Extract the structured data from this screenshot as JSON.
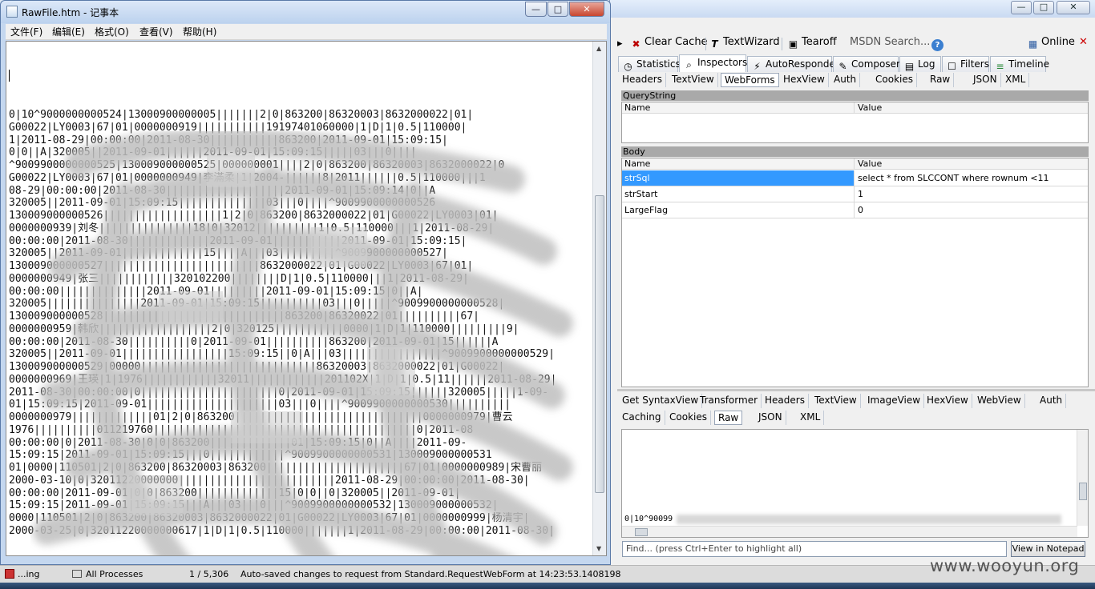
{
  "notepad": {
    "title": "RawFile.htm - 记事本",
    "menus": [
      "文件(F)",
      "编辑(E)",
      "格式(O)",
      "查看(V)",
      "帮助(H)"
    ],
    "window_buttons": {
      "minimize": "—",
      "maximize": "□",
      "close": "✕"
    },
    "lines": [
      "0|10^9000000000524|13000900000005|||||||2|0|863200|86320003|8632000022|01|",
      "G00022|LY0003|67|01|0000000919|||||||||||19197401060000|1|D|1|0.5|110000|",
      "1|2011-08-29|00:00:00|2011-08-30|||||||||||863200|2011-09-01|15:09:15|",
      "0|0||A|320005||2011-09-01||||||2011-09-01|15:09:15|||||03|||0||||",
      "^9009900000000525|130009000000525|000000001||||2|0|863200|86320003|8632000022|0",
      "G00022|LY0003|67|01|0000000949|李滿柔|1|2004-||||||8|2011||||||0.5|110000|||1",
      "08-29|00:00:00|2011-08-30|||||||||||||||||||2011-09-01|15:09:14|0||A",
      "320005||2011-09-01|15:09:15||||||||||||||03|||0||||^9009900000000526",
      "130009000000526|||||||||||||||||||1|2|0|863200|8632000022|01|G00022|LY0003|01|",
      "0000000939|刘冬|||||||||||||||18|0|32012||||||||||1|0.5|110000|||1|2011-08-29|",
      "00:00:00|2011-08-30|||||||||||||2011-09-01|||||||||||2011-09-01|15:09:15|",
      "320005||2011-09-01|||||||||||||15||||A|||03|||||||||^9009900000000527|",
      "130009000000527|||||||||||||||||||||||||8632000022|01|G00022|LY0003|67|01|",
      "0000000949|张三||||||||||||320102200||||||||D|1|0.5|110000|||1|2011-08-29|",
      "00:00:00||||||||||||||2011-09-01|||||||||2011-09-01|15:09:15|0||A|",
      "320005|||||||||||||||2011-09-01|15:09:15||||||||||03|||0|||||^9009900000000528|",
      "130009000000528|||||||||||||||||||||||||||||863200|86320022|01||||||||||67|",
      "0000000959|韩欣||||||||||||||||||2|0|320125|||||||||||0000|1|D|1|110000|||||||||9|",
      "00:00:00|2011-08-30||||||||||0|2011-09-01||||||||||863200|2011-09-01|15||||||A",
      "320005||2011-09-01|||||||||||||||||15:09:15||0|A|||03||||||||||||||||^9009900000000529|",
      "130009000000529|00000||||||||||||||||||||||||||||86320003|8632000022|01|G00022|",
      "0000000969|王瑛|1|1976||||||||||||32011||||||||||||201102X|1|D|1|0.5|11||||||2011-08-29|",
      "2011-08-30|00:00:00|0||||||||||||||||||||||0|2011-09-01|15:09:15||||||320005|||||1-09-",
      "01|15:09:15|2011-09-01|||||||||||||||||||||03|||0||||^9009900000000530||||||||||",
      "0000000979|||||||||||||01|2|0|863200||||||||||||||||||||||||||||||0000000979|曹云",
      "1976||||||||||011219760||||||||||||||||||||||||||||||||||||||||||0|2011-08",
      "00:00:00|0|2011-08-30|0|0|863200|||||||||||||01|15:09:15|0||A||||2011-09-",
      "15:09:15|2011-09-01|15:09:15|||0||||||||||||^9009900000000531|130009000000531",
      "01|0000|110501|2|0|863200|86320003|863200||||||||||||||||||||||67|01|0000000989|宋曹丽",
      "2000-03-10|0|32011220000000|||||||||||||||||||||||||2011-08-29|00:00:00|2011-08-30|",
      "00:00:00|2011-09-01|0|0|863200|||||||||||||15|0|0||0|320005||2011-09-01|",
      "15:09:15|2011-09-01|15:09:15|||A|||03|||0|||^9009900000000532|130009000000532|",
      "0000|110501|2|0|863200|86320003|8632000022|01|G00022|LY0003|67|01|0000000999|杨清宇|",
      "2000-03-25|0|32011220000000617|1|D|1|0.5|110000|||||||1|2011-08-29|00:00:00|2011-08-30|"
    ]
  },
  "fiddler": {
    "window_buttons": {
      "minimize": "—",
      "maximize": "□",
      "close": "✕"
    },
    "toolbar": [
      {
        "label": "Clear Cache",
        "icon": "✖"
      },
      {
        "label": "TextWizard",
        "icon": "T"
      },
      {
        "label": "Tearoff",
        "icon": "▣"
      },
      {
        "label": "MSDN Search...",
        "icon": ""
      },
      {
        "label": "",
        "icon": "?"
      },
      {
        "label": "Online",
        "icon": "▦"
      },
      {
        "label": "",
        "icon": "✕"
      }
    ],
    "main_tabs": [
      {
        "label": "Statistics",
        "icon": "◷"
      },
      {
        "label": "Inspectors",
        "icon": "⌕"
      },
      {
        "label": "AutoResponder",
        "icon": "⚡"
      },
      {
        "label": "Composer",
        "icon": "✎"
      },
      {
        "label": "Log",
        "icon": "▤"
      },
      {
        "label": "Filters",
        "icon": "☐"
      },
      {
        "label": "Timeline",
        "icon": "≡"
      }
    ],
    "request_tabs": [
      "Headers",
      "TextView",
      "WebForms",
      "HexView",
      "Auth",
      "Cookies",
      "Raw",
      "JSON",
      "XML"
    ],
    "querystring": {
      "title": "QueryString",
      "col_name": "Name",
      "col_value": "Value"
    },
    "body": {
      "title": "Body",
      "col_name": "Name",
      "col_value": "Value",
      "rows": [
        {
          "name": "strSql",
          "value": "select * from SLCCONT where rownum <11"
        },
        {
          "name": "strStart",
          "value": "1"
        },
        {
          "name": "LargeFlag",
          "value": "0"
        }
      ]
    },
    "response_tabs_row1": [
      "Get SyntaxView",
      "Transformer",
      "Headers",
      "TextView",
      "ImageView",
      "HexView",
      "WebView",
      "Auth"
    ],
    "response_tabs_row2": [
      "Caching",
      "Cookies",
      "Raw",
      "JSON",
      "XML"
    ],
    "response_text": "0|10^90099",
    "find_placeholder": "Find... (press Ctrl+Enter to highlight all)",
    "view_in_notepad": "View in Notepad"
  },
  "statusbar": {
    "capturing": "...ing",
    "processes": "All Processes",
    "counter": "1 / 5,306",
    "message": "Auto-saved changes to request from Standard.RequestWebForm at 14:23:53.1408198"
  },
  "watermark": "www.wooyun.org"
}
